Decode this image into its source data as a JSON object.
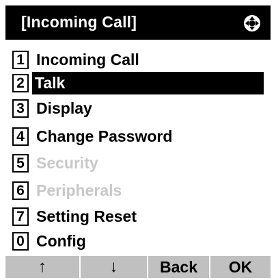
{
  "header": {
    "title": "[Incoming Call]",
    "nav_icon": "four-way-navigation-icon"
  },
  "menu": {
    "items": [
      {
        "number": "1",
        "label": "Incoming Call",
        "state": "normal"
      },
      {
        "number": "2",
        "label": "Talk",
        "state": "selected"
      },
      {
        "number": "3",
        "label": "Display",
        "state": "normal"
      },
      {
        "number": "4",
        "label": "Change Password",
        "state": "normal"
      },
      {
        "number": "5",
        "label": "Security",
        "state": "disabled"
      },
      {
        "number": "6",
        "label": "Peripherals",
        "state": "disabled"
      },
      {
        "number": "7",
        "label": "Setting Reset",
        "state": "normal"
      },
      {
        "number": "0",
        "label": "Config",
        "state": "normal"
      }
    ]
  },
  "softkeys": {
    "up": "↑",
    "down": "↓",
    "back": "Back",
    "ok": "OK"
  },
  "colors": {
    "header_bg": "#000000",
    "selected_bg": "#000000",
    "disabled_text": "#c8c8c8",
    "softkey_bar": "#c0c0c0"
  }
}
